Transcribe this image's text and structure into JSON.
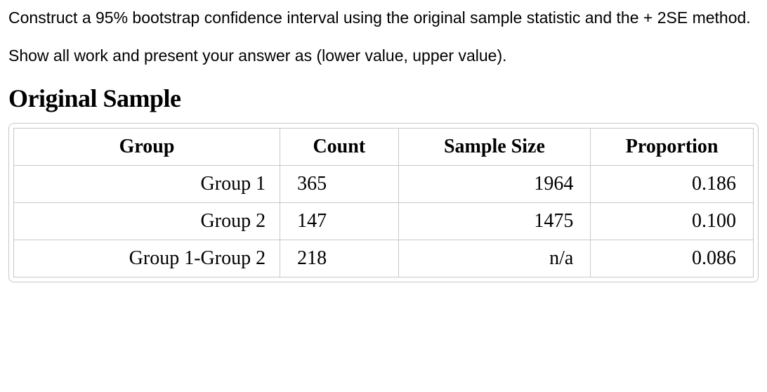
{
  "instructions": {
    "line1": "Construct a 95% bootstrap confidence interval using the original sample statistic and the + 2SE method.",
    "line2": "Show all work and present your answer as (lower value, upper value)."
  },
  "section_heading": "Original Sample",
  "table": {
    "headers": {
      "group": "Group",
      "count": "Count",
      "sample_size": "Sample Size",
      "proportion": "Proportion"
    },
    "rows": [
      {
        "group": "Group 1",
        "count": "365",
        "sample_size": "1964",
        "proportion": "0.186"
      },
      {
        "group": "Group 2",
        "count": "147",
        "sample_size": "1475",
        "proportion": "0.100"
      },
      {
        "group": "Group 1-Group 2",
        "count": "218",
        "sample_size": "n/a",
        "proportion": "0.086"
      }
    ]
  },
  "chart_data": {
    "type": "table",
    "title": "Original Sample",
    "columns": [
      "Group",
      "Count",
      "Sample Size",
      "Proportion"
    ],
    "rows": [
      [
        "Group 1",
        365,
        1964,
        0.186
      ],
      [
        "Group 2",
        147,
        1475,
        0.1
      ],
      [
        "Group 1-Group 2",
        218,
        null,
        0.086
      ]
    ]
  }
}
